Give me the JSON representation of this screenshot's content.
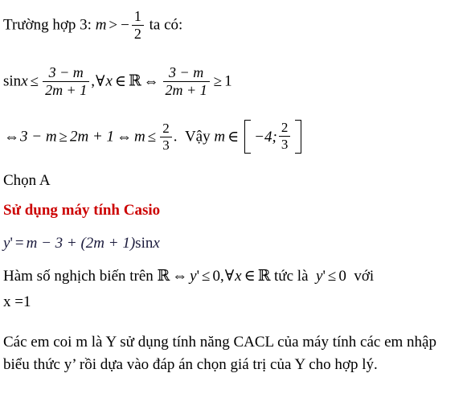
{
  "document": {
    "language": "vi",
    "colors": {
      "text": "#000000",
      "heading_red": "#cc0000",
      "formula_navy": "#1a1a3c",
      "background": "#ffffff"
    },
    "lines": {
      "case_label": "Trường hợp 3:",
      "case_var": "m",
      "case_gt": ">",
      "case_minus": "−",
      "case_frac_num": "1",
      "case_frac_den": "2",
      "case_tail": "ta có:",
      "l2_sin": "sin",
      "l2_x": "x",
      "l2_le": "≤",
      "l2_frac1_num": "3 − m",
      "l2_frac1_den": "2m + 1",
      "l2_comma": ",",
      "l2_forall": "∀",
      "l2_var": "x",
      "l2_in": "∈",
      "l2_R": "ℝ",
      "l2_iff": "⇔",
      "l2_frac2_num": "3 − m",
      "l2_frac2_den": "2m + 1",
      "l2_ge": "≥",
      "l2_one": "1",
      "l3_iff": "⇔",
      "l3_lhs": "3 − m",
      "l3_ge": "≥",
      "l3_rhs": "2m + 1",
      "l3_iff2": "⇔",
      "l3_m": "m",
      "l3_le": "≤",
      "l3_frac_num": "2",
      "l3_frac_den": "3",
      "l3_period": ".",
      "l3_vay": "Vậy",
      "l3_m2": "m",
      "l3_in": "∈",
      "l3_interval_left": "−4;",
      "l3_interval_num": "2",
      "l3_interval_den": "3",
      "chon_a": "Chọn A",
      "casio_heading": "Sử dụng máy tính Casio",
      "yprime_y": "y",
      "yprime_mark": "'",
      "yprime_eq": "=",
      "yprime_rhs1": "m − 3 +",
      "yprime_paren": "(2m + 1)",
      "yprime_sin": "sin",
      "yprime_x": "x",
      "l6_a": "Hàm số nghịch biến trên",
      "l6_R": "ℝ",
      "l6_iff": "⇔",
      "l6_y": "y",
      "l6_mark": "'",
      "l6_le": "≤",
      "l6_zero": "0,",
      "l6_forall": "∀",
      "l6_x": "x",
      "l6_in": "∈",
      "l6_R2": "ℝ",
      "l6_tuc": "tức là",
      "l6_y2": "y",
      "l6_mark2": "'",
      "l6_le2": "≤",
      "l6_zero2": "0",
      "l6_voi": "với",
      "l7_x_eq_1": "x =1",
      "final_para": "Các em coi m là Y sử dụng tính năng CACL của máy tính các em nhập biểu thức y’ rồi dựa vào đáp án chọn giá trị của Y cho hợp lý."
    }
  }
}
